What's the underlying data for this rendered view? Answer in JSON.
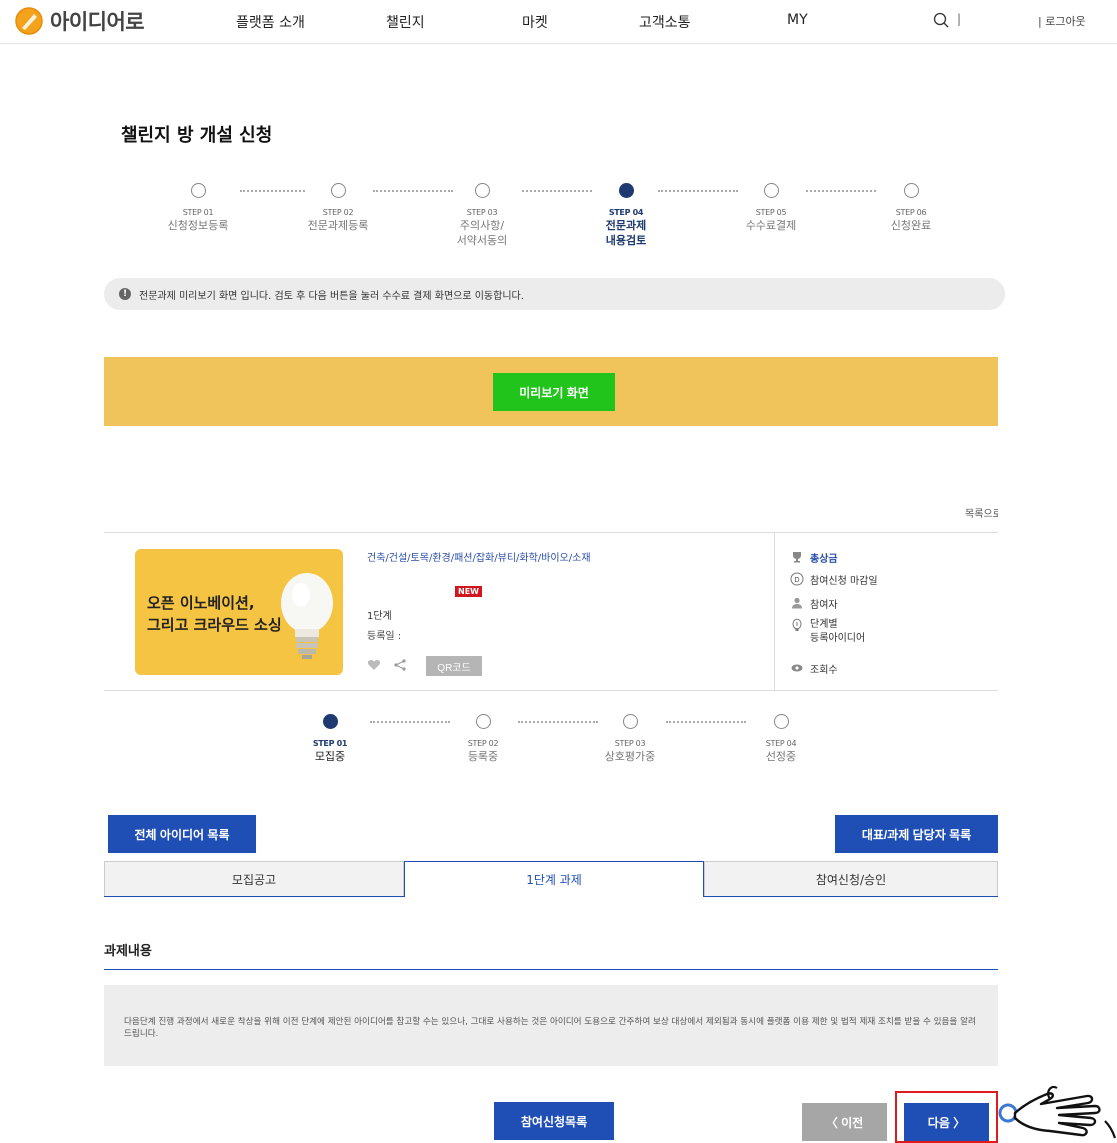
{
  "header": {
    "logo_text": "아이디어로",
    "nav": [
      "플랫폼 소개",
      "챌린지",
      "마켓",
      "고객소통",
      "MY"
    ],
    "separator": "|",
    "logout": "| 로그아웃"
  },
  "page_title": "챌린지 방 개설 신청",
  "steps": [
    {
      "num": "STEP 01",
      "name": "신청정보등록"
    },
    {
      "num": "STEP 02",
      "name": "전문과제등록"
    },
    {
      "num": "STEP 03",
      "name": "주의사항/\n서약서동의"
    },
    {
      "num": "STEP 04",
      "name": "전문과제\n내용검토",
      "active": true
    },
    {
      "num": "STEP 05",
      "name": "수수료결제"
    },
    {
      "num": "STEP 06",
      "name": "신청완료"
    }
  ],
  "notice": {
    "icon": "!",
    "text": "전문과제 미리보기 화면 입니다. 검토 후 다음 버튼을 눌러 수수료 결제 화면으로 이동합니다."
  },
  "preview_button": "미리보기 화면",
  "list_link": "목록으로",
  "card": {
    "thumb_line1": "오픈 이노베이션,",
    "thumb_line2": "그리고 크라우드 소싱",
    "category": "건축/건설/토목/환경/패션/잡화/뷰티/화학/바이오/소재",
    "badge": "NEW",
    "stage": "1단계",
    "reg_date": "등록일 :",
    "qr_label": "QR코드",
    "meta": {
      "prize": "총상금",
      "deadline_icon": "D",
      "deadline": "참여신청 마감일",
      "participants": "참여자",
      "stage_ideas": "단계별\n등록아이디어",
      "views": "조회수"
    }
  },
  "progress_steps": [
    {
      "num": "STEP 01",
      "name": "모집중",
      "active": true
    },
    {
      "num": "STEP 02",
      "name": "등록중"
    },
    {
      "num": "STEP 03",
      "name": "상호평가중"
    },
    {
      "num": "STEP 04",
      "name": "선정중"
    }
  ],
  "buttons": {
    "all_ideas": "전체 아이디어 목록",
    "managers": "대표/과제 담당자 목록",
    "participation_list": "참여신청목록",
    "prev": "〈  이전",
    "next": "다음  〉"
  },
  "tabs": [
    "모집공고",
    "1단계 과제",
    "참여신청/승인"
  ],
  "active_tab": 1,
  "section_title": "과제내용",
  "warning_text": "다음단계 진행 과정에서 새로운 착상을 위해 이전 단계에 제안된 아이디어를 참고할 수는 있으나, 그대로 사용하는 것은 아이디어 도용으로 간주하여 보상 대상에서 제외됨과 동시에 플랫폼 이용 제한 및 법적 제재 조치를 받을 수 있음을 알려드립니다.",
  "colors": {
    "brand_blue": "#1f4fb5",
    "step_active": "#1e3a70",
    "banner_yellow": "#f0c45a",
    "preview_green": "#20c41a",
    "highlight_red": "#e01b1b"
  }
}
